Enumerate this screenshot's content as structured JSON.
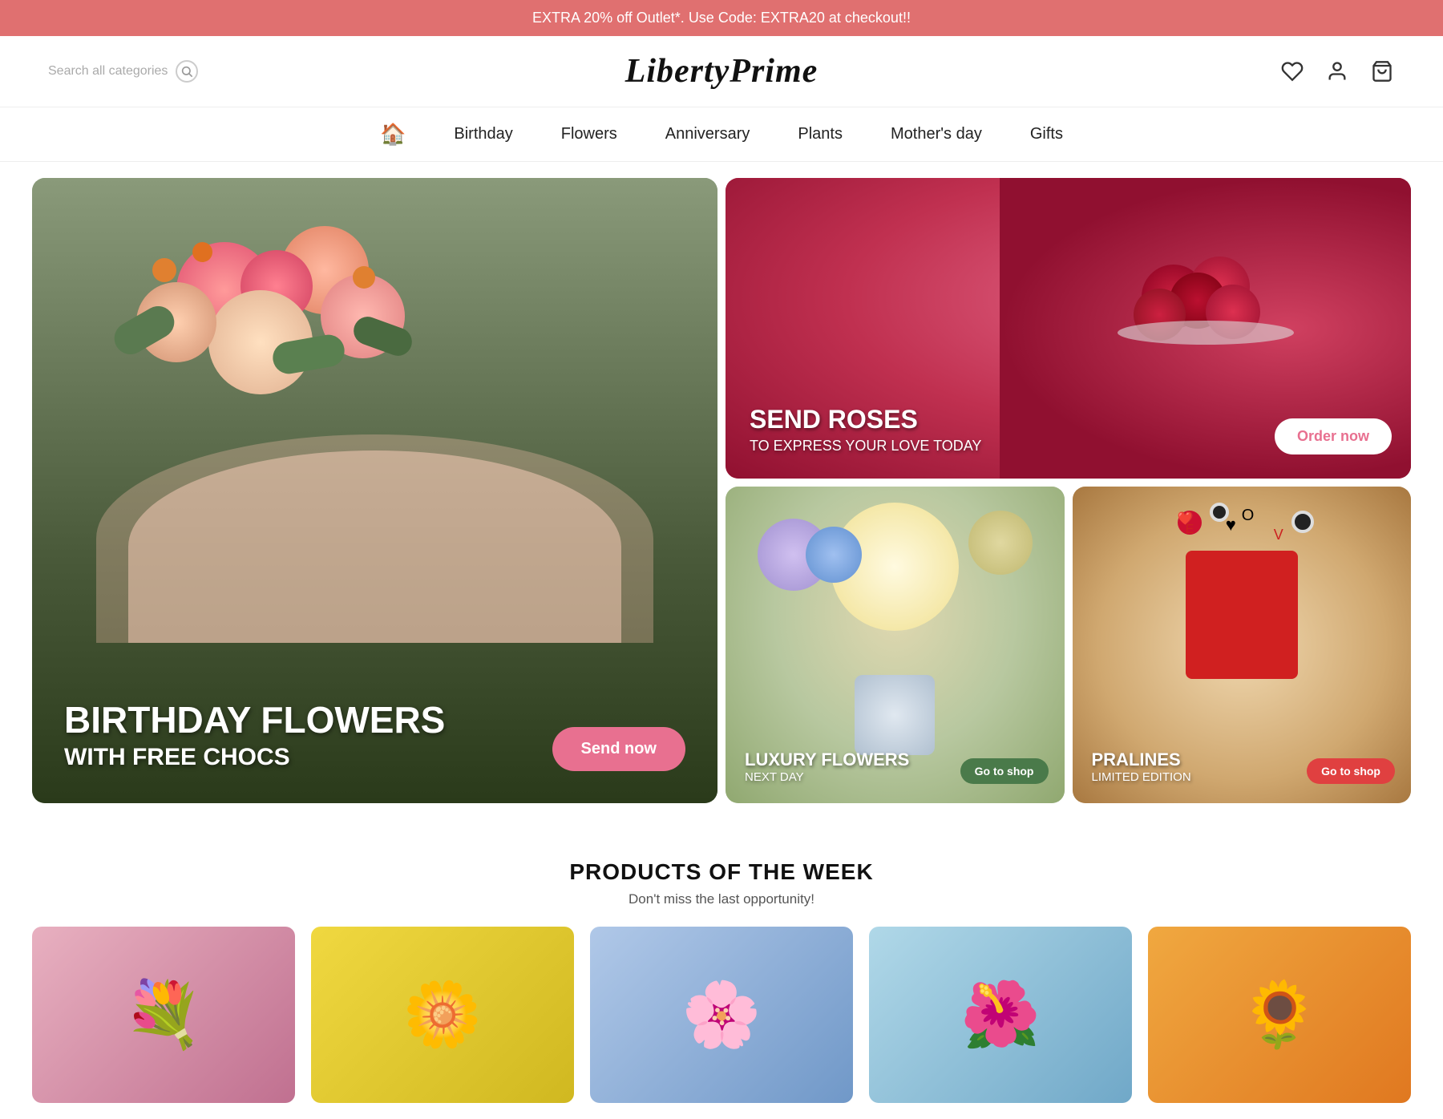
{
  "banner": {
    "text": "EXTRA 20% off Outlet*. Use Code: EXTRA20 at checkout!!"
  },
  "header": {
    "search_placeholder": "Search all categories",
    "logo": "LibertyPrime"
  },
  "nav": {
    "home_icon": "🏠",
    "items": [
      {
        "label": "Birthday",
        "id": "birthday"
      },
      {
        "label": "Flowers",
        "id": "flowers"
      },
      {
        "label": "Anniversary",
        "id": "anniversary"
      },
      {
        "label": "Plants",
        "id": "plants"
      },
      {
        "label": "Mother's day",
        "id": "mothers-day"
      },
      {
        "label": "Gifts",
        "id": "gifts"
      }
    ]
  },
  "hero": {
    "main": {
      "title": "BIRTHDAY FLOWERS",
      "subtitle": "WITH FREE CHOCS",
      "button": "Send now"
    },
    "roses": {
      "title": "SEND ROSES",
      "subtitle": "TO EXPRESS YOUR LOVE TODAY",
      "button": "Order now"
    },
    "luxury": {
      "title": "LUXURY FLOWERS",
      "subtitle": "NEXT DAY",
      "button": "Go to shop"
    },
    "pralines": {
      "title": "PRALINES",
      "subtitle": "LIMITED EDITION",
      "button": "Go to shop"
    }
  },
  "products": {
    "title": "PRODUCTS OF THE WEEK",
    "subtitle": "Don't miss the last opportunity!",
    "items": [
      {
        "id": "product-1",
        "emoji": "💐"
      },
      {
        "id": "product-2",
        "emoji": "🌼"
      },
      {
        "id": "product-3",
        "emoji": "🌸"
      },
      {
        "id": "product-4",
        "emoji": "🌺"
      },
      {
        "id": "product-5",
        "emoji": "🌻"
      }
    ]
  },
  "colors": {
    "banner_bg": "#e07070",
    "accent": "#e87090",
    "nav_home": "#e07070"
  }
}
